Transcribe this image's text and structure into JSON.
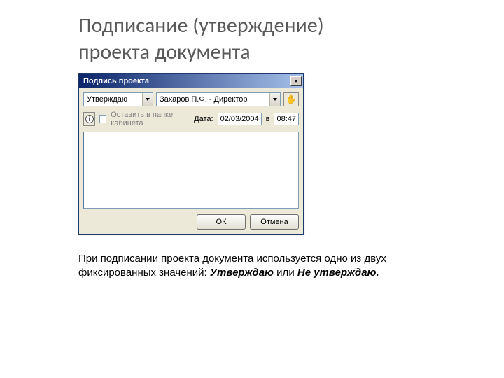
{
  "slide": {
    "title_line1": "Подписание (утверждение)",
    "title_line2": "проекта документа"
  },
  "dialog": {
    "title": "Подпись проекта",
    "close": "×",
    "action_value": "Утверждаю",
    "person_value": "Захаров П.Ф. - Директор",
    "hand_icon": "✋",
    "info_icon": "i",
    "keep_in_folder_label": "Оставить в папке кабинета",
    "date_label": "Дата:",
    "date_value": "02/03/2004",
    "at_label": "в",
    "time_value": "08:47",
    "ok_label": "ОК",
    "cancel_label": "Отмена"
  },
  "caption": {
    "pre": "При подписании проекта документа используется одно из двух фиксированных значений: ",
    "opt1": "Утверждаю",
    "mid": " или ",
    "opt2": "Не утверждаю."
  }
}
